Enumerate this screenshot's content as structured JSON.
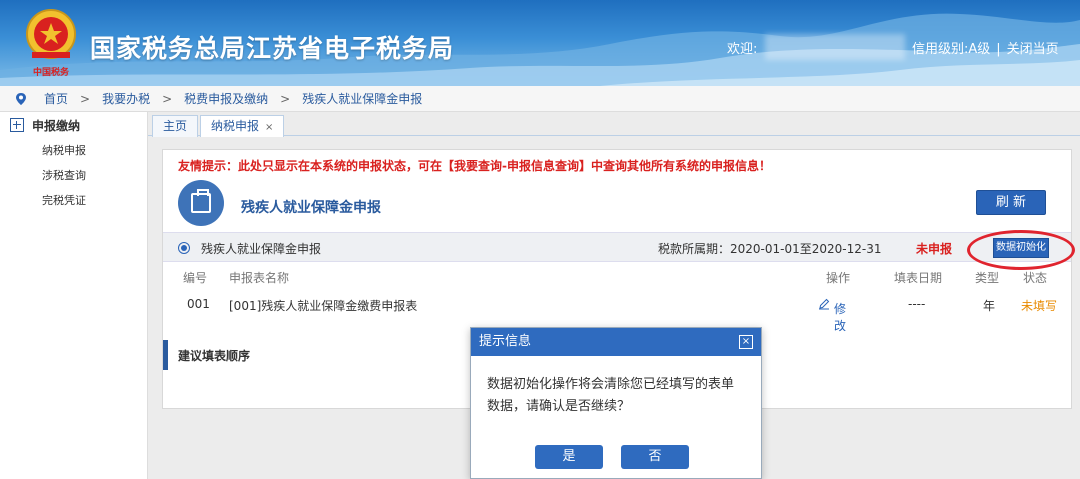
{
  "header": {
    "site_title": "国家税务总局江苏省电子税务局",
    "welcome": "欢迎:",
    "credit_level": "信用级别:A级",
    "close_page": "关闭当页"
  },
  "breadcrumb": [
    "首页",
    "我要办税",
    "税费申报及缴纳",
    "残疾人就业保障金申报"
  ],
  "sidebar": {
    "heading": "申报缴纳",
    "items": [
      "纳税申报",
      "涉税查询",
      "完税凭证"
    ]
  },
  "tabs": [
    {
      "label": "主页"
    },
    {
      "label": "纳税申报",
      "close": "×"
    }
  ],
  "panel": {
    "tip": "友情提示：此处只显示在本系统的申报状态，可在【我要查询-申报信息查询】中查询其他所有系统的申报信息！",
    "form_title": "残疾人就业保障金申报",
    "refresh_label": "刷 新",
    "band": {
      "name": "残疾人就业保障金申报",
      "period": "税款所属期：2020-01-01至2020-12-31",
      "status": "未申报",
      "init_button": "数据初始化"
    },
    "table": {
      "headers": [
        "编号",
        "申报表名称",
        "操作",
        "填表日期",
        "类型",
        "状态"
      ],
      "rows": [
        {
          "no": "001",
          "name": "[001]残疾人就业保障金缴费申报表",
          "action": "修改",
          "date": "----",
          "type": "年",
          "status": "未填写"
        }
      ]
    },
    "section_label": "建议填表顺序"
  },
  "modal": {
    "title": "提示信息",
    "close": "×",
    "message": "数据初始化操作将会清除您已经填写的表单数据，请确认是否继续？",
    "yes": "是",
    "no": "否"
  },
  "colors": {
    "primary": "#2f6bbf",
    "warning": "#d9211f",
    "pending": "#e88a00"
  }
}
